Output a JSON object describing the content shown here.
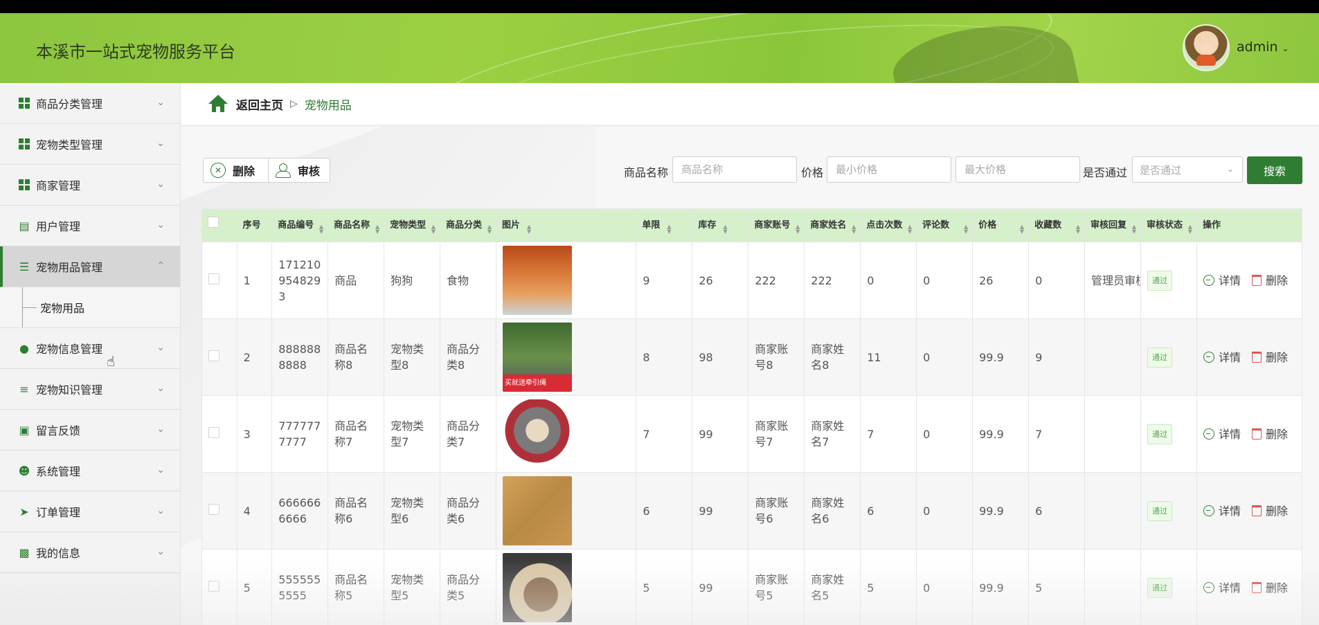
{
  "header": {
    "app_title": "本溪市一站式宠物服务平台",
    "user_name": "admin",
    "colors": {
      "brand": "#8cc63f",
      "accent": "#2e7d32"
    }
  },
  "sidebar": {
    "items": [
      {
        "label": "商品分类管理",
        "icon": "grid-icon"
      },
      {
        "label": "宠物类型管理",
        "icon": "grid-icon"
      },
      {
        "label": "商家管理",
        "icon": "grid-icon"
      },
      {
        "label": "用户管理",
        "icon": "clipboard-icon"
      },
      {
        "label": "宠物用品管理",
        "icon": "list-icon"
      },
      {
        "label": "宠物信息管理",
        "icon": "balloon-icon"
      },
      {
        "label": "宠物知识管理",
        "icon": "sliders-icon"
      },
      {
        "label": "留言反馈",
        "icon": "briefcase-icon"
      },
      {
        "label": "系统管理",
        "icon": "user-icon"
      },
      {
        "label": "订单管理",
        "icon": "paper-plane-icon"
      },
      {
        "label": "我的信息",
        "icon": "card-icon"
      }
    ],
    "sub_item": "宠物用品"
  },
  "breadcrumb": {
    "back": "返回主页",
    "current": "宠物用品"
  },
  "toolbar": {
    "delete_label": "删除",
    "audit_label": "审核"
  },
  "filters": {
    "name_label": "商品名称",
    "name_placeholder": "商品名称",
    "price_label": "价格",
    "min_price_placeholder": "最小价格",
    "max_price_placeholder": "最大价格",
    "pass_label": "是否通过",
    "pass_placeholder": "是否通过",
    "search_label": "搜索"
  },
  "table": {
    "headers": [
      "序号",
      "商品编号",
      "商品名称",
      "宠物类型",
      "商品分类",
      "图片",
      "单限",
      "库存",
      "商家账号",
      "商家姓名",
      "点击次数",
      "评论数",
      "价格",
      "收藏数",
      "审核回复",
      "审核状态",
      "操作"
    ],
    "rows": [
      {
        "index": "1",
        "code": "1712109548293",
        "name": "商品",
        "pet_type": "狗狗",
        "category": "食物",
        "image": "dog-with-bowls-photo",
        "limit": "9",
        "stock": "26",
        "account": "222",
        "merchant": "222",
        "clicks": "0",
        "comments": "0",
        "price": "26",
        "favorites": "0",
        "reply": "管理员审核",
        "status": "通过"
      },
      {
        "index": "2",
        "code": "8888888888",
        "name": "商品名称8",
        "pet_type": "宠物类型8",
        "category": "商品分类8",
        "image": "cat-harness-photo",
        "image_caption": "买就送牵引绳",
        "limit": "8",
        "stock": "98",
        "account": "商家账号8",
        "merchant": "商家姓名8",
        "clicks": "11",
        "comments": "0",
        "price": "99.9",
        "favorites": "9",
        "reply": "",
        "status": "通过"
      },
      {
        "index": "3",
        "code": "7777777777",
        "name": "商品名称7",
        "pet_type": "宠物类型7",
        "category": "商品分类7",
        "image": "pet-bed-photo",
        "limit": "7",
        "stock": "99",
        "account": "商家账号7",
        "merchant": "商家姓名7",
        "clicks": "7",
        "comments": "0",
        "price": "99.9",
        "favorites": "7",
        "reply": "",
        "status": "通过"
      },
      {
        "index": "4",
        "code": "6666666666",
        "name": "商品名称6",
        "pet_type": "宠物类型6",
        "category": "商品分类6",
        "image": "pet-bowls-photo",
        "limit": "6",
        "stock": "99",
        "account": "商家账号6",
        "merchant": "商家姓名6",
        "clicks": "6",
        "comments": "0",
        "price": "99.9",
        "favorites": "6",
        "reply": "",
        "status": "通过"
      },
      {
        "index": "5",
        "code": "5555555555",
        "name": "商品名称5",
        "pet_type": "宠物类型5",
        "category": "商品分类5",
        "image": "cat-wheel-photo",
        "limit": "5",
        "stock": "99",
        "account": "商家账号5",
        "merchant": "商家姓名5",
        "clicks": "5",
        "comments": "0",
        "price": "99.9",
        "favorites": "5",
        "reply": "",
        "status": "通过"
      }
    ],
    "actions": {
      "detail": "详情",
      "delete": "删除"
    }
  }
}
